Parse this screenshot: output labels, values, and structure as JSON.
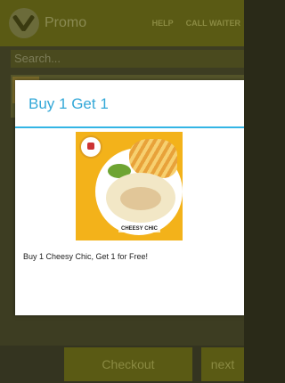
{
  "action_bar": {
    "app_title": "Promo",
    "help_label": "HELP",
    "call_waiter_label": "CALL WAITER"
  },
  "search": {
    "placeholder": "Search..."
  },
  "dialog": {
    "title": "Buy 1 Get 1",
    "image_caption": "CHEESY CHIC",
    "message": "Buy 1 Cheesy Chic, Get 1 for Free!"
  },
  "bottom": {
    "checkout_label": "Checkout",
    "next_label": "next"
  },
  "colors": {
    "accent": "#33b5e5",
    "action_bar_dimmed": "#5a5a14"
  }
}
